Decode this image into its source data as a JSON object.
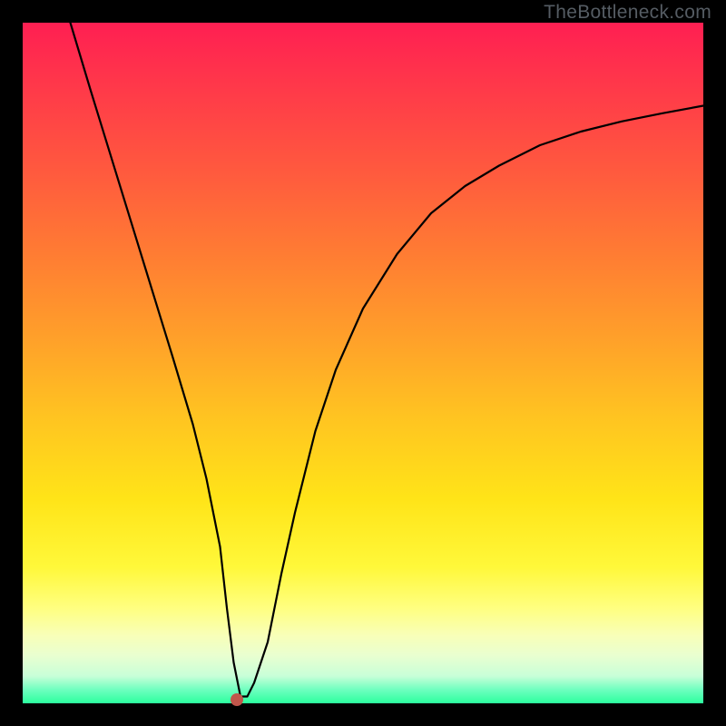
{
  "watermark": "TheBottleneck.com",
  "chart_data": {
    "type": "line",
    "title": "",
    "xlabel": "",
    "ylabel": "",
    "xlim": [
      0,
      100
    ],
    "ylim": [
      0,
      100
    ],
    "series": [
      {
        "name": "curve",
        "x": [
          7,
          10,
          14,
          18,
          22,
          25,
          27,
          29,
          30,
          31,
          32,
          33,
          34,
          36,
          38,
          40,
          43,
          46,
          50,
          55,
          60,
          65,
          70,
          76,
          82,
          88,
          94,
          100
        ],
        "values": [
          100,
          90,
          77,
          64,
          51,
          41,
          33,
          23,
          14,
          6,
          1,
          1,
          3,
          9,
          19,
          28,
          40,
          49,
          58,
          66,
          72,
          76,
          79,
          82,
          84,
          85.5,
          86.7,
          87.8
        ]
      }
    ],
    "marker": {
      "x": 31.5,
      "y": 0.5
    }
  }
}
